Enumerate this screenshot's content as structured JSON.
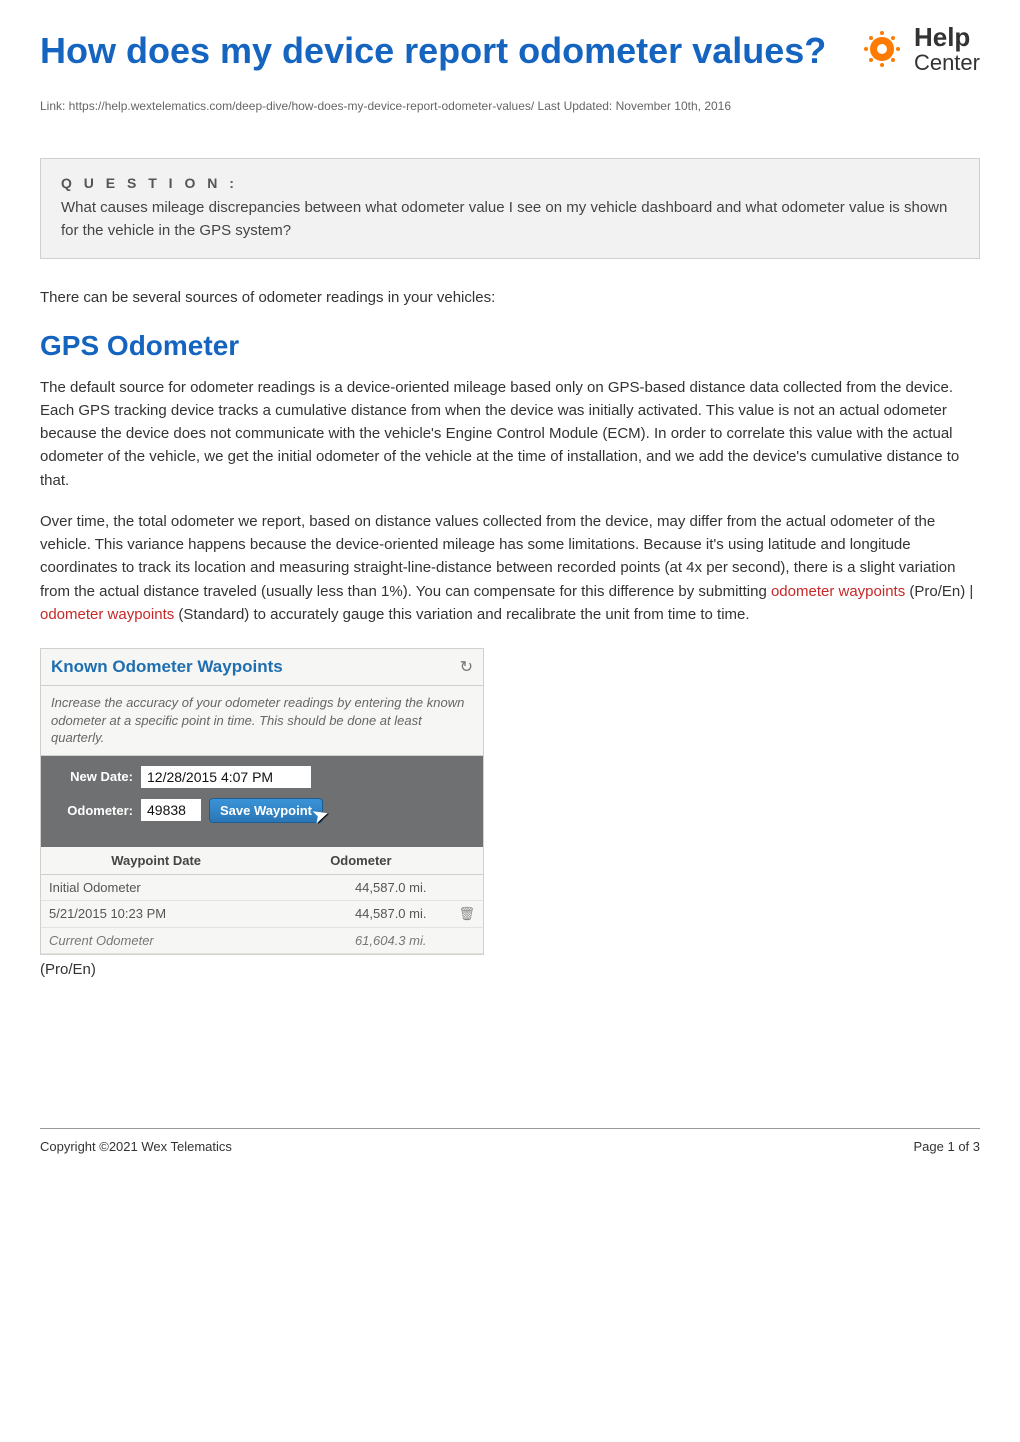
{
  "header": {
    "title": "How does my device report odometer values?",
    "brand_help": "Help",
    "brand_center": "Center"
  },
  "link_bar": "Link: https://help.wextelematics.com/deep-dive/how-does-my-device-report-odometer-values/ Last Updated: November 10th, 2016",
  "question": {
    "label": "Q U E S T I O N :",
    "text": "What causes mileage discrepancies between what odometer value I see on my vehicle dashboard and what odometer value is shown for the vehicle in the GPS system?"
  },
  "intro": "There can be several sources of odometer readings in your vehicles:",
  "section_heading": "GPS Odometer",
  "para1": "The default source for odometer readings is a device-oriented mileage based only on GPS-based distance data collected from the device. Each GPS tracking device tracks a cumulative distance from when the device was initially activated. This value is not an actual odometer because the device does not communicate with the vehicle's Engine Control Module (ECM). In order to correlate this value with the actual odometer of the vehicle, we get the initial odometer of the vehicle at the time of installation, and we add the device's cumulative distance to that.",
  "para2_a": "Over time, the total odometer we report, based on distance values collected from the device, may differ from the actual odometer of the vehicle. This variance happens because the device-oriented mileage has some limitations. Because it's using latitude and longitude coordinates to track its location and measuring straight-line-distance between recorded points (at 4x per second), there is a slight variation from the actual distance traveled (usually less than 1%). You can compensate for this difference by submitting ",
  "para2_link1": "odometer waypoints",
  "para2_mid": " (Pro/En) | ",
  "para2_link2": "odometer waypoints",
  "para2_b": " (Standard) to accurately gauge this variation and recalibrate the unit from time to time.",
  "card": {
    "title": "Known Odometer Waypoints",
    "desc": "Increase the accuracy of your odometer readings by entering the known odometer at a specific point in time. This should be done at least quarterly.",
    "label_date": "New Date:",
    "value_date": "12/28/2015 4:07 PM",
    "label_odo": "Odometer:",
    "value_odo": "49838",
    "save_btn": "Save Waypoint",
    "col_date": "Waypoint Date",
    "col_odo": "Odometer",
    "rows": [
      {
        "date": "Initial Odometer",
        "odo": "44,587.0 mi.",
        "action": ""
      },
      {
        "date": "5/21/2015 10:23 PM",
        "odo": "44,587.0 mi.",
        "action": "trash"
      },
      {
        "date": "Current Odometer",
        "odo": "61,604.3 mi.",
        "action": "",
        "current": true
      }
    ]
  },
  "label_under": "(Pro/En)",
  "footer": {
    "left": "Copyright ©2021 Wex Telematics",
    "right": "Page 1 of 3"
  }
}
